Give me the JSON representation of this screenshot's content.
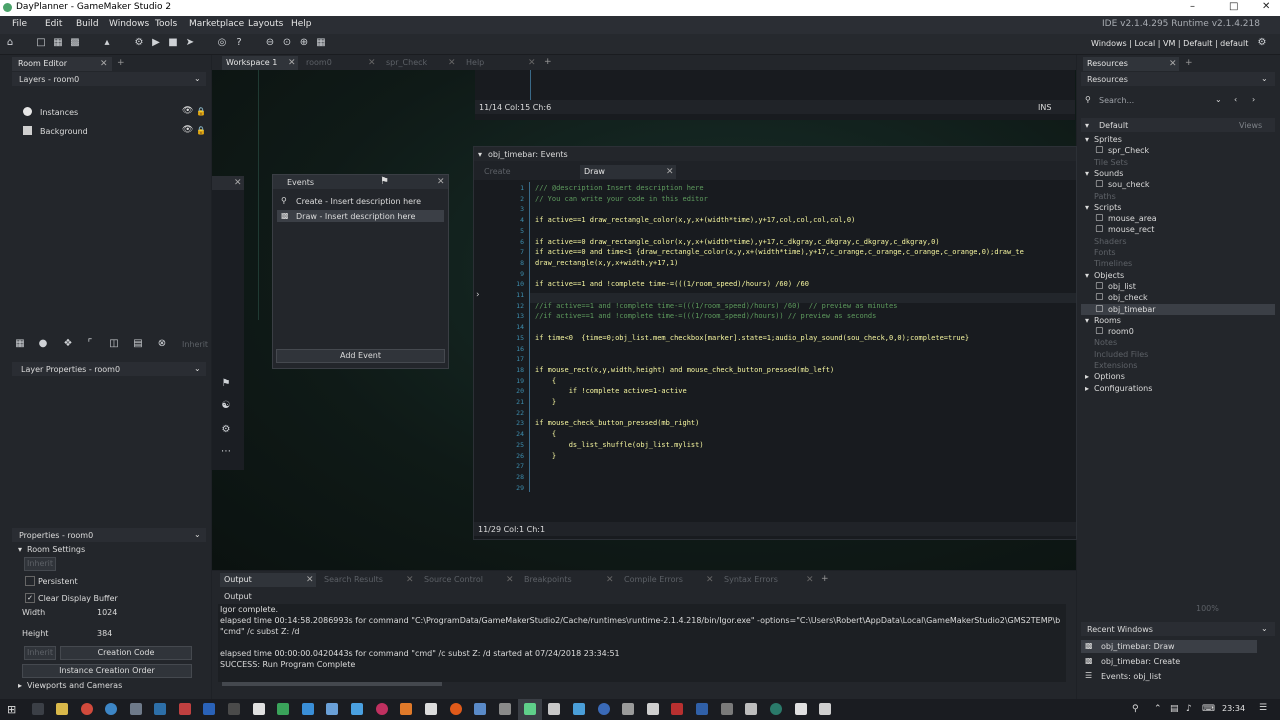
{
  "window": {
    "title": "DayPlanner - GameMaker Studio 2",
    "ide_version": "IDE v2.1.4.295 Runtime v2.1.4.218"
  },
  "menu": [
    "File",
    "Edit",
    "Build",
    "Windows",
    "Tools",
    "Marketplace",
    "Layouts",
    "Help"
  ],
  "toolbar": {
    "target": "Windows | Local | VM | Default | default"
  },
  "room_editor": {
    "tab": "Room Editor",
    "layers_title": "Layers - room0",
    "layers": [
      "Instances",
      "Background"
    ],
    "inherit": "Inherit",
    "layer_props_title": "Layer Properties - room0"
  },
  "properties": {
    "title": "Properties - room0",
    "room_settings": "Room Settings",
    "inherit": "Inherit",
    "persistent": "Persistent",
    "clear_display": "Clear Display Buffer",
    "width_label": "Width",
    "width_value": "1024",
    "height_label": "Height",
    "height_value": "384",
    "inherit2": "Inherit",
    "creation_code": "Creation Code",
    "instance_order": "Instance Creation Order",
    "viewports": "Viewports and Cameras"
  },
  "workspace_tabs": [
    {
      "label": "Workspace 1",
      "active": true
    },
    {
      "label": "room0",
      "active": false
    },
    {
      "label": "spr_Check",
      "active": false
    },
    {
      "label": "Help",
      "active": false
    }
  ],
  "top_editor": {
    "status": "11/14 Col:15 Ch:6",
    "mode": "INS"
  },
  "events_window": {
    "title": "Events",
    "items": [
      "Create - Insert description here",
      "Draw - Insert description here"
    ],
    "add_event": "Add Event"
  },
  "code_window": {
    "title": "obj_timebar: Events",
    "tabs": [
      {
        "label": "Create",
        "active": false
      },
      {
        "label": "Draw",
        "active": true
      }
    ],
    "status": "11/29 Col:1 Ch:1",
    "lines": [
      {
        "n": "1",
        "t": "/// @description Insert description here",
        "c": "cm"
      },
      {
        "n": "2",
        "t": "// You can write your code in this editor",
        "c": "cm"
      },
      {
        "n": "3",
        "t": "",
        "c": ""
      },
      {
        "n": "4",
        "t": "if active==1 draw_rectangle_color(x,y,x+(width*time),y+17,col,col,col,col,0)",
        "c": "kw"
      },
      {
        "n": "5",
        "t": "",
        "c": ""
      },
      {
        "n": "6",
        "t": "if active==0 draw_rectangle_color(x,y,x+(width*time),y+17,c_dkgray,c_dkgray,c_dkgray,c_dkgray,0)",
        "c": "kw"
      },
      {
        "n": "7",
        "t": "if active==0 and time<1 {draw_rectangle_color(x,y,x+(width*time),y+17,c_orange,c_orange,c_orange,c_orange,0);draw_te",
        "c": "kw"
      },
      {
        "n": "8",
        "t": "draw_rectangle(x,y,x+width,y+17,1)",
        "c": "kw"
      },
      {
        "n": "9",
        "t": "",
        "c": ""
      },
      {
        "n": "10",
        "t": "if active==1 and !complete time-=(((1/room_speed)/hours) /60) /60",
        "c": "kw"
      },
      {
        "n": "11",
        "t": "",
        "c": ""
      },
      {
        "n": "12",
        "t": "//if active==1 and !complete time-=(((1/room_speed)/hours) /60)  // preview as minutes",
        "c": "cm"
      },
      {
        "n": "13",
        "t": "//if active==1 and !complete time-=(((1/room_speed)/hours)) // preview as seconds",
        "c": "cm"
      },
      {
        "n": "14",
        "t": "",
        "c": ""
      },
      {
        "n": "15",
        "t": "if time<0  {time=0;obj_list.mem_checkbox[marker].state=1;audio_play_sound(sou_check,0,0);complete=true}",
        "c": "kw"
      },
      {
        "n": "16",
        "t": "",
        "c": ""
      },
      {
        "n": "17",
        "t": "",
        "c": ""
      },
      {
        "n": "18",
        "t": "if mouse_rect(x,y,width,height) and mouse_check_button_pressed(mb_left)",
        "c": "kw"
      },
      {
        "n": "19",
        "t": "    {",
        "c": "kw"
      },
      {
        "n": "20",
        "t": "        if !complete active=1-active",
        "c": "kw"
      },
      {
        "n": "21",
        "t": "    }",
        "c": "kw"
      },
      {
        "n": "22",
        "t": "",
        "c": ""
      },
      {
        "n": "23",
        "t": "if mouse_check_button_pressed(mb_right)",
        "c": "kw"
      },
      {
        "n": "24",
        "t": "    {",
        "c": "kw"
      },
      {
        "n": "25",
        "t": "        ds_list_shuffle(obj_list.mylist)",
        "c": "kw"
      },
      {
        "n": "26",
        "t": "    }",
        "c": "kw"
      },
      {
        "n": "27",
        "t": "",
        "c": ""
      },
      {
        "n": "28",
        "t": "",
        "c": ""
      },
      {
        "n": "29",
        "t": "",
        "c": ""
      }
    ]
  },
  "output_tabs": [
    {
      "label": "Output",
      "active": true
    },
    {
      "label": "Search Results",
      "active": false
    },
    {
      "label": "Source Control",
      "active": false
    },
    {
      "label": "Breakpoints",
      "active": false
    },
    {
      "label": "Compile Errors",
      "active": false
    },
    {
      "label": "Syntax Errors",
      "active": false
    }
  ],
  "output": {
    "header": "Output",
    "lines": [
      "Igor complete.",
      "elapsed time 00:14:58.2086993s for command \"C:\\ProgramData/GameMakerStudio2/Cache/runtimes\\runtime-2.1.4.218/bin/Igor.exe\" -options=\"C:\\Users\\Robert\\AppData\\Local\\GameMakerStudio2\\GMS2TEMP\\build.bff\" -- Wine",
      "\"cmd\" /c subst Z: /d",
      "",
      "elapsed time 00:00:00.0420443s for command \"cmd\" /c subst Z: /d started at 07/24/2018 23:34:51",
      "SUCCESS: Run Program Complete"
    ]
  },
  "resources": {
    "tab": "Resources",
    "title": "Resources",
    "search_placeholder": "Search...",
    "default": "Default",
    "views": "Views",
    "tree": [
      {
        "label": "Sprites",
        "type": "group",
        "dim": false
      },
      {
        "label": "spr_Check",
        "type": "item",
        "dim": false
      },
      {
        "label": "Tile Sets",
        "type": "group",
        "dim": true
      },
      {
        "label": "Sounds",
        "type": "group",
        "dim": false
      },
      {
        "label": "sou_check",
        "type": "item",
        "dim": false
      },
      {
        "label": "Paths",
        "type": "group",
        "dim": true
      },
      {
        "label": "Scripts",
        "type": "group",
        "dim": false
      },
      {
        "label": "mouse_area",
        "type": "item",
        "dim": false
      },
      {
        "label": "mouse_rect",
        "type": "item",
        "dim": false
      },
      {
        "label": "Shaders",
        "type": "group",
        "dim": true
      },
      {
        "label": "Fonts",
        "type": "group",
        "dim": true
      },
      {
        "label": "Timelines",
        "type": "group",
        "dim": true
      },
      {
        "label": "Objects",
        "type": "group",
        "dim": false
      },
      {
        "label": "obj_list",
        "type": "item",
        "dim": false
      },
      {
        "label": "obj_check",
        "type": "item",
        "dim": false
      },
      {
        "label": "obj_timebar",
        "type": "item",
        "dim": false
      },
      {
        "label": "Rooms",
        "type": "group",
        "dim": false
      },
      {
        "label": "room0",
        "type": "item",
        "dim": false
      },
      {
        "label": "Notes",
        "type": "group",
        "dim": true
      },
      {
        "label": "Included Files",
        "type": "group",
        "dim": true
      },
      {
        "label": "Extensions",
        "type": "group",
        "dim": true
      },
      {
        "label": "Options",
        "type": "group",
        "dim": false
      },
      {
        "label": "Configurations",
        "type": "group",
        "dim": false
      }
    ],
    "zoom": "100%"
  },
  "recent": {
    "title": "Recent Windows",
    "items": [
      "obj_timebar: Draw",
      "obj_timebar: Create",
      "Events: obj_list"
    ]
  },
  "taskbar": {
    "time": "23:34"
  },
  "colors": {
    "accent": "#2d7fb8",
    "keyword": "#f7f7a0",
    "comment": "#5e9c5e"
  }
}
